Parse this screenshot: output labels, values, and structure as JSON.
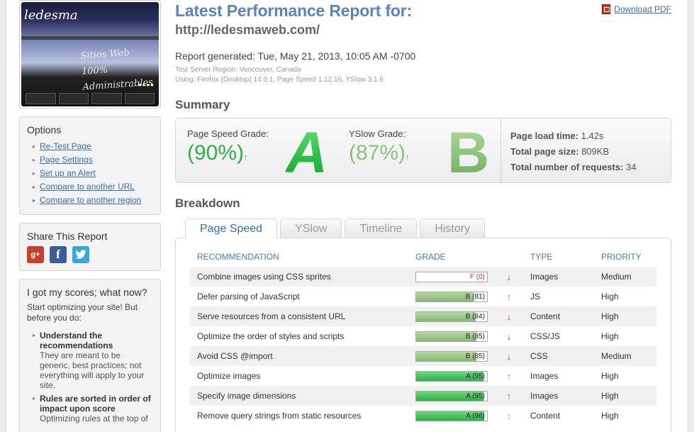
{
  "sidebar": {
    "thumbnail": {
      "logo": "ledesma",
      "script_line1": "Sitios Web 100%",
      "script_line2": "Administrables"
    },
    "options": {
      "title": "Options",
      "items": [
        "Re-Test Page",
        "Page Settings",
        "Set up an Alert",
        "Compare to another URL",
        "Compare to another region"
      ]
    },
    "share": {
      "title": "Share This Report",
      "icons": [
        "google-plus-icon",
        "facebook-icon",
        "twitter-icon"
      ]
    },
    "now_what": {
      "title": "I got my scores; what now?",
      "intro": "Start optimizing your site! But before you do:",
      "tips": [
        {
          "heading": "Understand the recommendations",
          "body": "They are meant to be generic, best practices; not everything will apply to your site."
        },
        {
          "heading": "Rules are sorted in order of impact upon score",
          "body": "Optimizing rules at the top of"
        }
      ]
    }
  },
  "header": {
    "title": "Latest Performance Report for:",
    "url": "http://ledesmaweb.com/",
    "download_pdf": "Download PDF",
    "generated": "Report generated: Tue, May 21, 2013, 10:05 AM -0700",
    "server_region": "Test Server Region: Vancouver, Canada",
    "using": "Using: Firefox (Desktop) 14.0.1, Page Speed 1.12.16, YSlow 3.1.6"
  },
  "summary": {
    "heading": "Summary",
    "pagespeed": {
      "label": "Page Speed Grade:",
      "pct": "(90%)",
      "letter": "A",
      "trend": "↑"
    },
    "yslow": {
      "label": "YSlow Grade:",
      "pct": "(87%)",
      "letter": "B",
      "trend": "↑"
    },
    "stats": {
      "load_label": "Page load time:",
      "load_value": "1.42s",
      "size_label": "Total page size:",
      "size_value": "809KB",
      "requests_label": "Total number of requests:",
      "requests_value": "34"
    }
  },
  "breakdown": {
    "heading": "Breakdown",
    "tabs": [
      "Page Speed",
      "YSlow",
      "Timeline",
      "History"
    ],
    "columns": [
      "RECOMMENDATION",
      "GRADE",
      "TYPE",
      "PRIORITY"
    ],
    "rows": [
      {
        "rec": "Combine images using CSS sprites",
        "grade": "F (0)",
        "score": 0,
        "trend": "↓",
        "type": "Images",
        "priority": "Medium"
      },
      {
        "rec": "Defer parsing of JavaScript",
        "grade": "B (81)",
        "score": 81,
        "trend": "↑",
        "type": "JS",
        "priority": "High"
      },
      {
        "rec": "Serve resources from a consistent URL",
        "grade": "B (84)",
        "score": 84,
        "trend": "↓",
        "type": "Content",
        "priority": "High"
      },
      {
        "rec": "Optimize the order of styles and scripts",
        "grade": "B (85)",
        "score": 85,
        "trend": "↓",
        "type": "CSS/JS",
        "priority": "High"
      },
      {
        "rec": "Avoid CSS @import",
        "grade": "B (85)",
        "score": 85,
        "trend": "↓",
        "type": "CSS",
        "priority": "Medium"
      },
      {
        "rec": "Optimize images",
        "grade": "A (95)",
        "score": 95,
        "trend": "↑",
        "type": "Images",
        "priority": "High"
      },
      {
        "rec": "Specify image dimensions",
        "grade": "A (95)",
        "score": 95,
        "trend": "↑",
        "type": "Images",
        "priority": "High"
      },
      {
        "rec": "Remove query strings from static resources",
        "grade": "A (96)",
        "score": 96,
        "trend": "↕",
        "type": "Content",
        "priority": "High"
      }
    ]
  },
  "colors": {
    "accent": "#5a84bc",
    "link": "#3a6cb0",
    "grade_a": "#2bc046",
    "grade_b": "#8cc27a",
    "grade_f": "#c0392b",
    "arrow_up": "#5aa43c",
    "arrow_down": "#c0392b",
    "arrow_neutral": "#e0a030"
  }
}
